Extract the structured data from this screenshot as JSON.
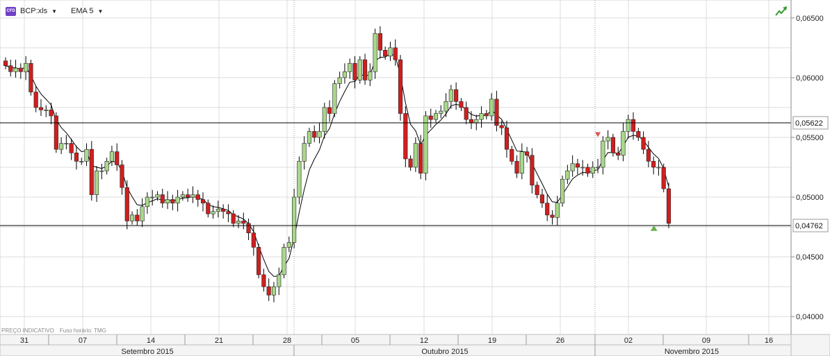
{
  "toolbar": {
    "instrument_badge": "CFD",
    "instrument": "BCP:xls",
    "indicator": "EMA 5"
  },
  "footnote": {
    "notice": "PREÇO INDICATIVO",
    "timezone": "Fuso horário: TMG"
  },
  "colors": {
    "up": "#a8d88a",
    "down": "#d01f1f",
    "ema": "#000000",
    "grid": "#dcdcdc",
    "hline": "#000000"
  },
  "chart_data": {
    "type": "candlestick",
    "title": "",
    "xlabel": "",
    "ylabel": "",
    "ylim": [
      0.0385,
      0.0665
    ],
    "y_ticks": [
      "0,04000",
      "0,04500",
      "0,05000",
      "0,05500",
      "0,06000",
      "0,06500"
    ],
    "y_tick_values": [
      0.04,
      0.045,
      0.05,
      0.055,
      0.06,
      0.065
    ],
    "x_day_labels": [
      "31",
      "07",
      "14",
      "21",
      "28",
      "05",
      "12",
      "19",
      "26",
      "02",
      "09",
      "16"
    ],
    "months": [
      "Setembro 2015",
      "Outubro 2015",
      "Novembro 2015"
    ],
    "horizontal_lines": [
      {
        "value": 0.05622,
        "label": "0,05622"
      },
      {
        "value": 0.04762,
        "label": "0,04762"
      }
    ],
    "indicator": "EMA 5",
    "close": [
      0.061,
      0.0605,
      0.0608,
      0.0605,
      0.0612,
      0.0588,
      0.0575,
      0.0573,
      0.0573,
      0.0568,
      0.054,
      0.0545,
      0.0545,
      0.0537,
      0.053,
      0.053,
      0.054,
      0.0502,
      0.0522,
      0.0522,
      0.053,
      0.0538,
      0.0527,
      0.0508,
      0.048,
      0.0485,
      0.048,
      0.0492,
      0.05,
      0.05,
      0.0502,
      0.0495,
      0.0498,
      0.0495,
      0.05,
      0.0502,
      0.05,
      0.0502,
      0.0498,
      0.0495,
      0.0486,
      0.0488,
      0.049,
      0.0488,
      0.0486,
      0.0478,
      0.048,
      0.0478,
      0.047,
      0.0458,
      0.0435,
      0.0425,
      0.0418,
      0.0425,
      0.0435,
      0.0458,
      0.0462,
      0.05,
      0.053,
      0.0545,
      0.0555,
      0.055,
      0.0555,
      0.0575,
      0.057,
      0.0595,
      0.06,
      0.0605,
      0.0612,
      0.0598,
      0.0615,
      0.0598,
      0.0605,
      0.0637,
      0.0623,
      0.0618,
      0.0625,
      0.0615,
      0.057,
      0.0532,
      0.0525,
      0.0545,
      0.052,
      0.0568,
      0.0565,
      0.057,
      0.0572,
      0.058,
      0.059,
      0.058,
      0.0575,
      0.0565,
      0.0562,
      0.0565,
      0.057,
      0.0568,
      0.0582,
      0.056,
      0.0558,
      0.054,
      0.053,
      0.052,
      0.0538,
      0.0535,
      0.051,
      0.0502,
      0.0495,
      0.0485,
      0.0483,
      0.0495,
      0.0515,
      0.0522,
      0.0528,
      0.0525,
      0.0525,
      0.052,
      0.0525,
      0.0525,
      0.0547,
      0.055,
      0.0537,
      0.0535,
      0.0555,
      0.0565,
      0.0555,
      0.055,
      0.054,
      0.053,
      0.0525,
      0.0525,
      0.0507,
      0.0478
    ]
  }
}
